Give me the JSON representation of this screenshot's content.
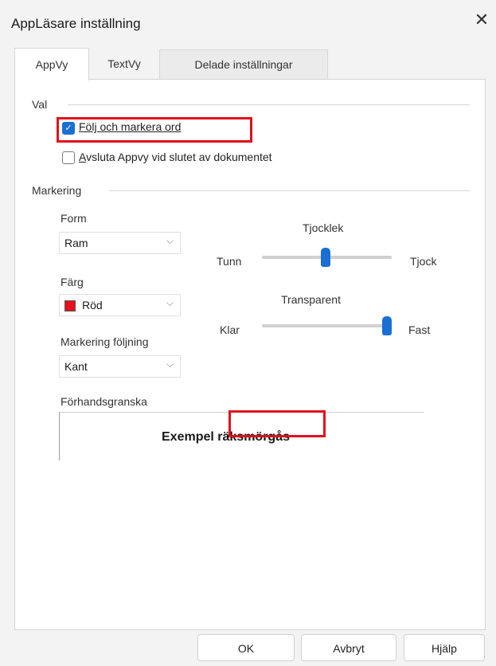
{
  "window": {
    "title": "AppLäsare inställning",
    "close_glyph": "✕"
  },
  "tabs": [
    {
      "label": "AppVy",
      "active": true
    },
    {
      "label": "TextVy",
      "active": false
    },
    {
      "label": "Delade inställningar",
      "active": false
    }
  ],
  "val": {
    "label": "Val",
    "options": [
      {
        "label": "Följ och markera ord",
        "checked": true
      },
      {
        "label": "Avsluta Appvy vid slutet av dokumentet",
        "checked": false
      }
    ]
  },
  "markering": {
    "label": "Markering",
    "form": {
      "label": "Form",
      "value": "Ram"
    },
    "farg": {
      "label": "Färg",
      "value": "Röd",
      "swatch_color": "#e8101a"
    },
    "foljning": {
      "label": "Markering följning",
      "value": "Kant"
    },
    "tjocklek": {
      "label": "Tjocklek",
      "min_label": "Tunn",
      "max_label": "Tjock",
      "level": 0.49
    },
    "transparent": {
      "label": "Transparent",
      "min_label": "Klar",
      "max_label": "Fast",
      "level": 1.0
    }
  },
  "preview": {
    "label": "Förhandsgranska",
    "word1": "Exempel",
    "word2": "räksmörgås"
  },
  "buttons": {
    "ok": "OK",
    "cancel": "Avbryt",
    "help": "Hjälp"
  },
  "colors": {
    "accent": "#1a6fd2",
    "highlight": "#e0101a"
  }
}
